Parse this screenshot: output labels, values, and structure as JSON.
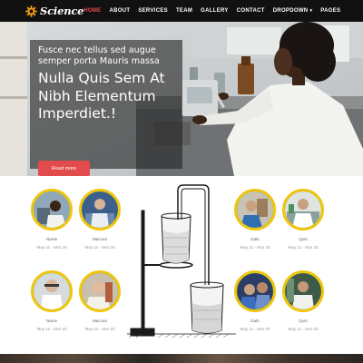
{
  "brand": {
    "name": "Science",
    "icon": "gear-icon",
    "color": "#f39c12"
  },
  "nav": {
    "items": [
      {
        "label": "HOME",
        "active": true
      },
      {
        "label": "ABOUT"
      },
      {
        "label": "SERVICES"
      },
      {
        "label": "TEAM"
      },
      {
        "label": "GALLERY"
      },
      {
        "label": "CONTACT"
      },
      {
        "label": "DROPDOWN",
        "caret": "chevron-down-icon"
      },
      {
        "label": "PAGES"
      }
    ],
    "active_color": "#e84c4c"
  },
  "hero": {
    "subtitle": "Fusce nec tellus sed augue semper porta Mauris massa",
    "title": "Nulla Quis Sem At Nibh Elementum Imperdiet.!",
    "button_label": "Read more",
    "button_color": "#e24b4b"
  },
  "team": {
    "members": [
      {
        "name": "Name",
        "date": "May 11 - Mar 20"
      },
      {
        "name": "Maccao",
        "date": "May 11 - Mar 20"
      },
      {
        "name": "Dalo",
        "date": "May 11 - Mar 20"
      },
      {
        "name": "Quis",
        "date": "May 11 - Mar 20"
      },
      {
        "name": "Name",
        "date": "May 11 - Mar 20"
      },
      {
        "name": "Maccao",
        "date": "May 11 - Mar 20"
      },
      {
        "name": "Dalo",
        "date": "May 11 - Mar 20"
      },
      {
        "name": "Quis",
        "date": "May 11 - Mar 20"
      }
    ],
    "avatar_border_color": "#f1c40f",
    "avatar_fill_color": "#2ecc71"
  }
}
